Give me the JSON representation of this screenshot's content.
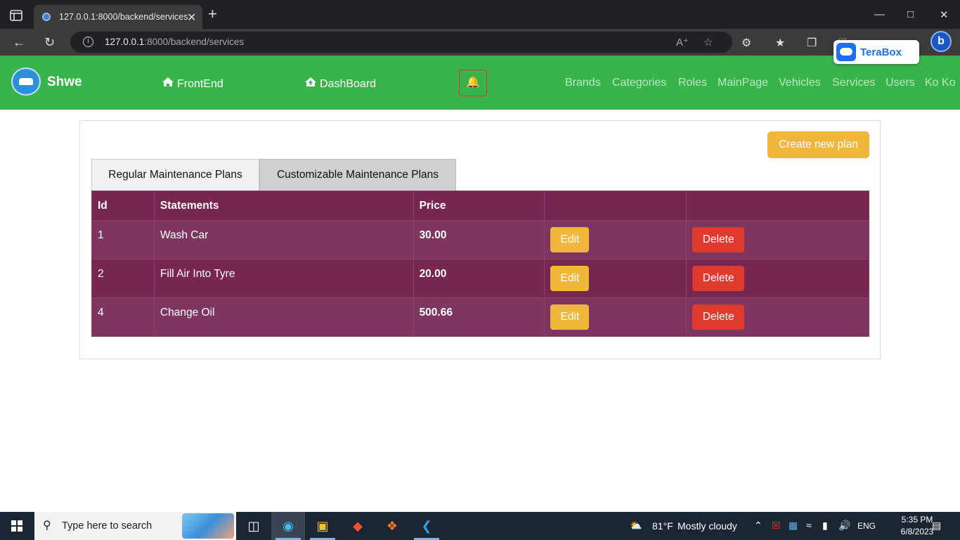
{
  "browser": {
    "tab_title": "127.0.0.1:8000/backend/services",
    "tab_close": "✕",
    "new_tab": "+",
    "url_host": "127.0.0.1",
    "url_path": ":8000/backend/services",
    "extension_label": "TeraBox",
    "bing_letter": "b"
  },
  "navbar": {
    "brand": "Shwe",
    "frontend": "FrontEnd",
    "dashboard": "DashBoard",
    "links": [
      "Brands",
      "Categories",
      "Roles",
      "MainPage",
      "Vehicles",
      "Services",
      "Users",
      "Ko Ko"
    ]
  },
  "content": {
    "create_button": "Create new plan",
    "tabs": [
      "Regular Maintenance Plans",
      "Customizable Maintenance Plans"
    ],
    "columns": [
      "Id",
      "Statements",
      "Price",
      "",
      ""
    ],
    "rows": [
      {
        "id": "1",
        "statement": "Wash Car",
        "price": "30.00"
      },
      {
        "id": "2",
        "statement": "Fill Air Into Tyre",
        "price": "20.00"
      },
      {
        "id": "4",
        "statement": "Change Oil",
        "price": "500.66"
      }
    ],
    "edit_label": "Edit",
    "delete_label": "Delete"
  },
  "taskbar": {
    "search_placeholder": "Type here to search",
    "temperature": "81°F",
    "weather": "Mostly cloudy",
    "language": "ENG",
    "time": "5:35 PM",
    "date": "6/8/2023"
  },
  "colors": {
    "navbar": "#38b44a",
    "table_dark": "#76264f",
    "table_light": "#7e3560",
    "edit_button": "#f0b73a",
    "delete_button": "#e03a2f"
  }
}
